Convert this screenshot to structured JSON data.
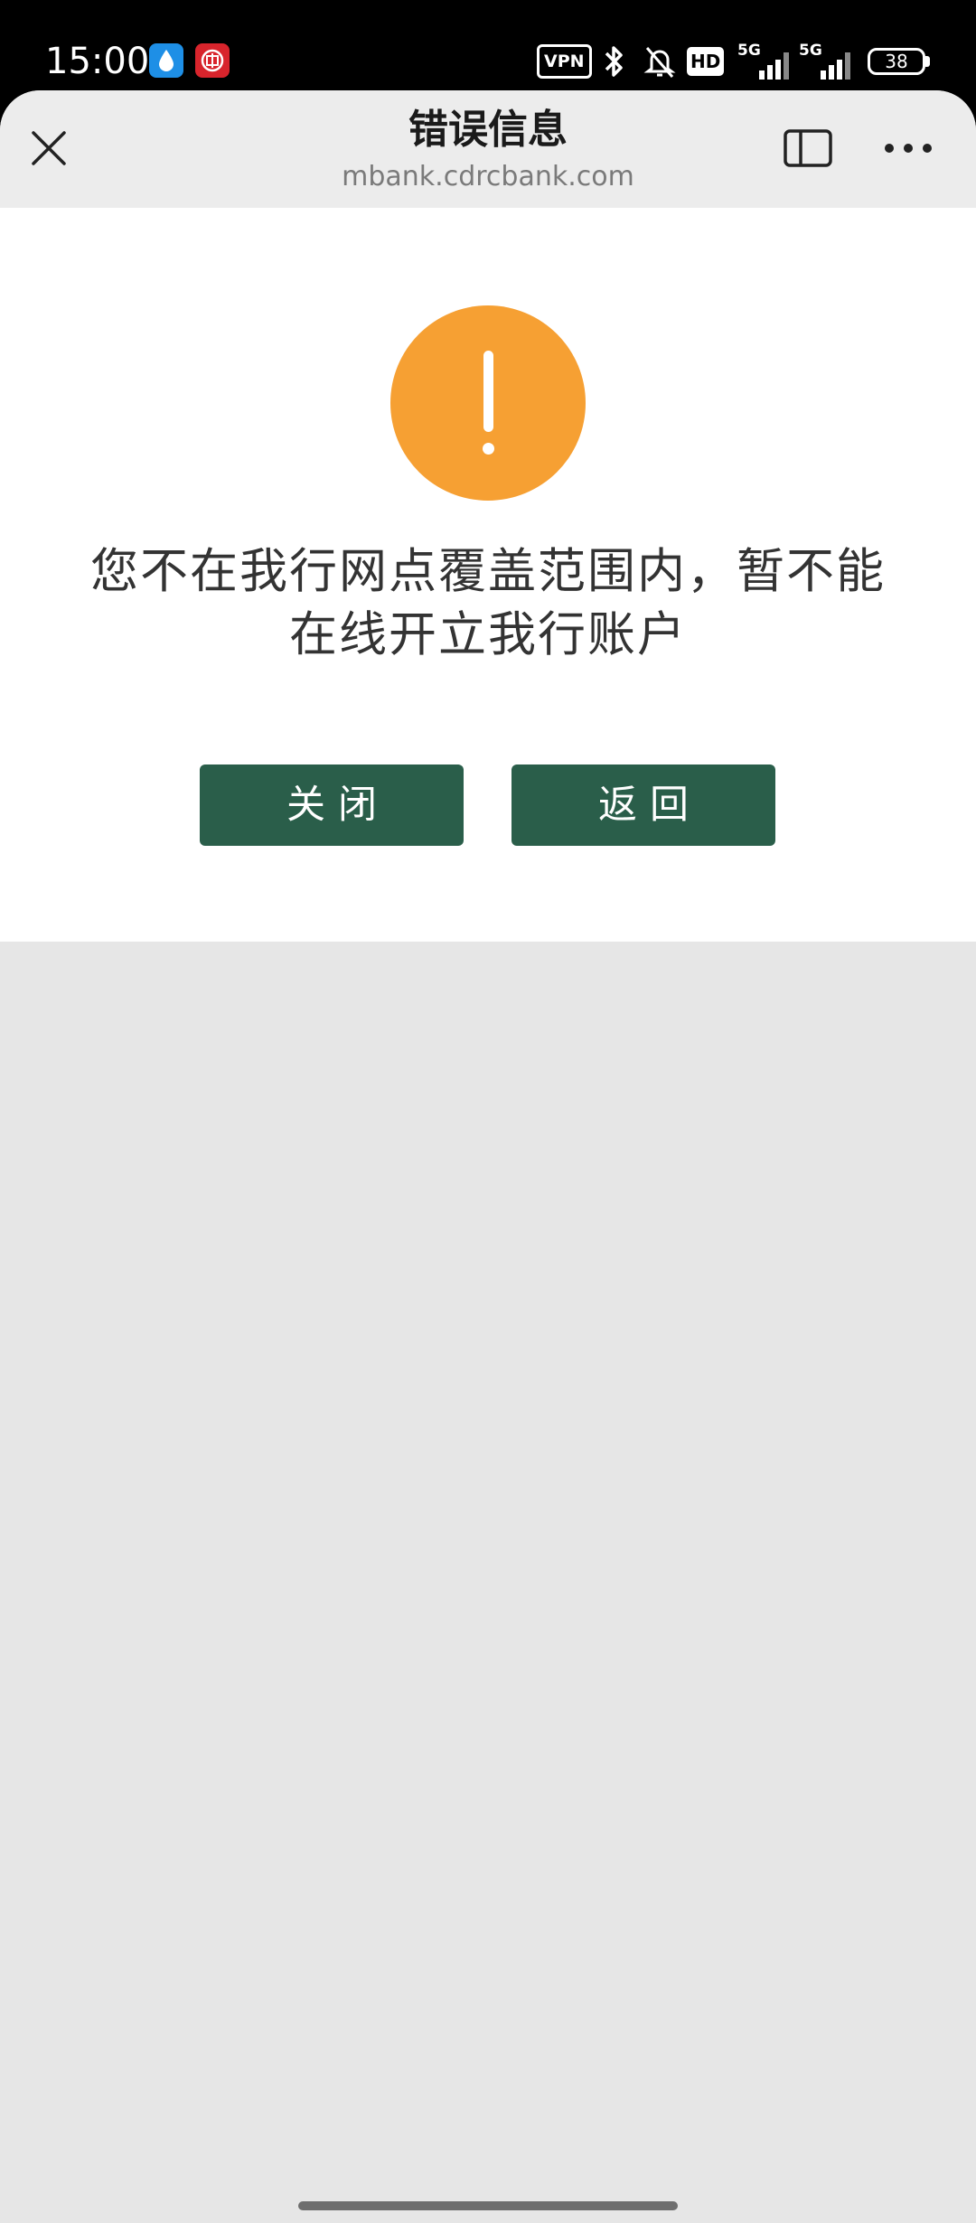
{
  "status_bar": {
    "time": "15:00",
    "vpn": "VPN",
    "hd": "HD",
    "network_1": "5G",
    "network_2": "5G",
    "battery": "38"
  },
  "browser": {
    "title": "错误信息",
    "url": "mbank.cdrcbank.com"
  },
  "dialog": {
    "icon": "warning-exclamation-icon",
    "icon_color": "#f6a033",
    "message_line1": "您不在我行网点覆盖范围内，暂不能",
    "message_line2": "在线开立我行账户",
    "buttons": {
      "close_label": "关闭",
      "back_label": "返回"
    },
    "button_color": "#2a5e4a"
  }
}
